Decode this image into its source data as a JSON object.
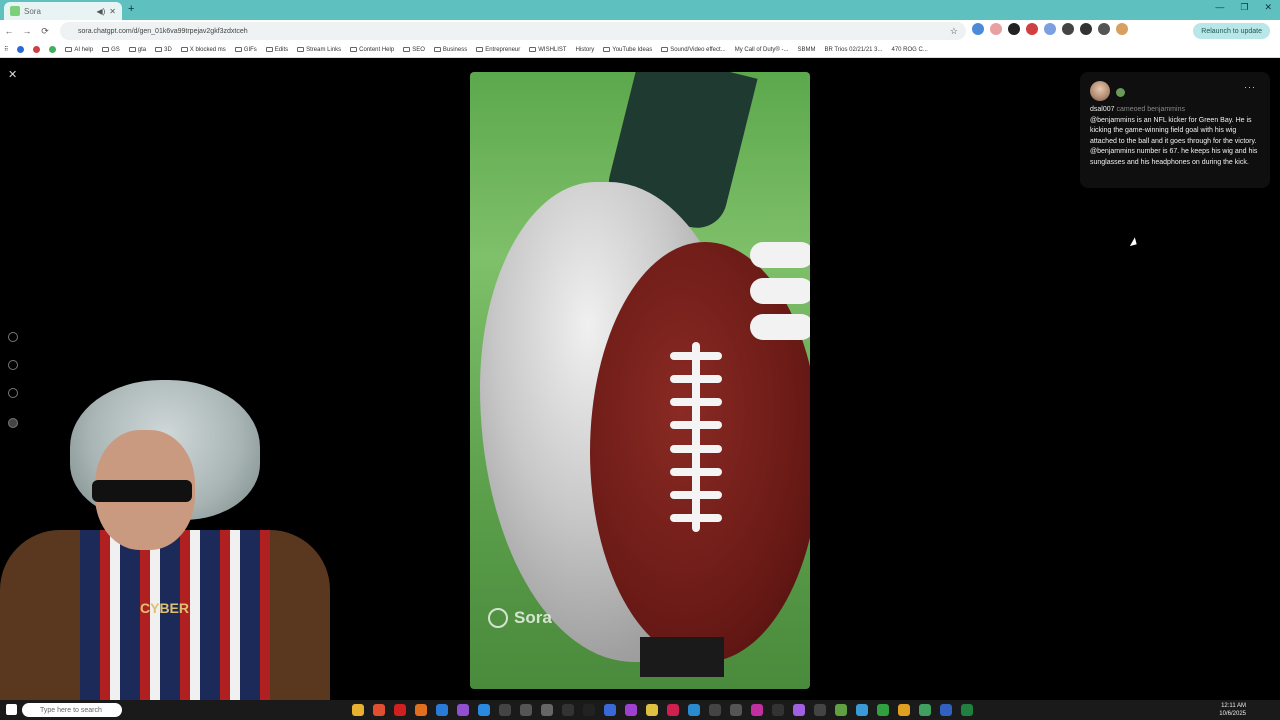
{
  "browser": {
    "tab_title": "Sora",
    "url": "sora.chatgpt.com/d/gen_01k6va99trpejav2gkf3zdxtceh",
    "relaunch_label": "Relaunch to update",
    "bookmarks": [
      "AI help",
      "GS",
      "gta",
      "3D",
      "X blocked ms",
      "GIFs",
      "Edits",
      "Stream Links",
      "Content Help",
      "SEO",
      "Business",
      "Entrepreneur",
      "WISHLIST",
      "History",
      "YouTube Ideas",
      "Sound/Video effect...",
      "My Call of Duty® -...",
      "SBMM",
      "BR Trios 02/21/21 3...",
      "470 ROG C..."
    ]
  },
  "viewer": {
    "watermark": "Sora"
  },
  "post": {
    "username": "dsal007",
    "action": "cameoed benjammins",
    "caption": "@benjammins is an NFL kicker for Green Bay. He is kicking the game-winning field goal with his wig attached to the ball and it goes through for the victory. @benjammins number is 67. he keeps his wig and his sunglasses and his headphones on during the kick.",
    "more": "···"
  },
  "webcam": {
    "chain_text": "CYBER"
  },
  "taskbar": {
    "search_placeholder": "Type here to search",
    "time": "12:11 AM",
    "date": "10/6/2025"
  },
  "colors": {
    "browser_chrome": "#5fc0c0",
    "page_bg": "#000000",
    "panel_bg": "#0f0f0f"
  }
}
